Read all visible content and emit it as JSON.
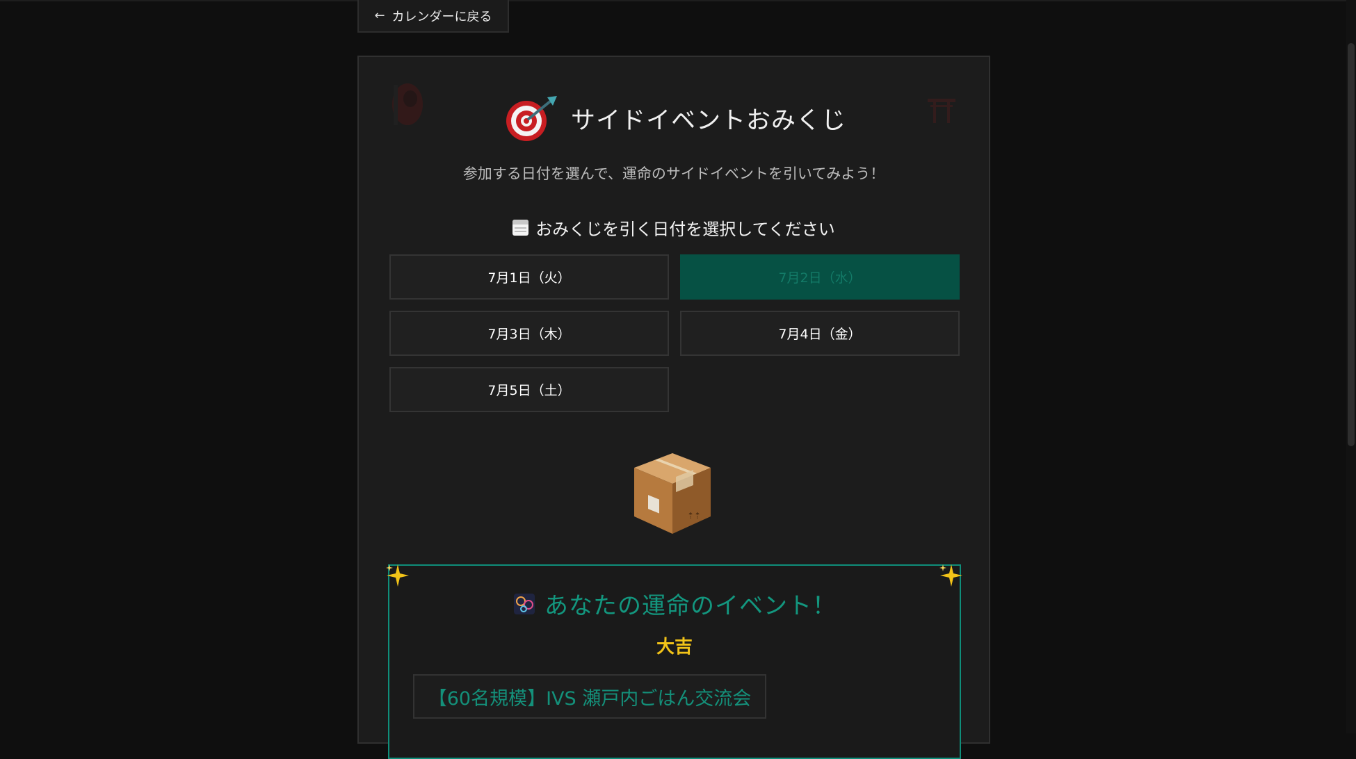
{
  "nav": {
    "back_label": "カレンダーに戻る",
    "back_icon": "arrow-left-icon"
  },
  "header": {
    "title": "サイドイベントおみくじ",
    "title_icon": "dart-target-icon",
    "subtitle": "参加する日付を選んで、運命のサイドイベントを引いてみよう！"
  },
  "date_select": {
    "heading": "おみくじを引く日付を選択してください",
    "heading_icon": "calendar-icon",
    "dates": [
      {
        "label": "7月1日（火）",
        "selected": false
      },
      {
        "label": "7月2日（水）",
        "selected": true
      },
      {
        "label": "7月3日（木）",
        "selected": false
      },
      {
        "label": "7月4日（金）",
        "selected": false
      },
      {
        "label": "7月5日（土）",
        "selected": false
      }
    ]
  },
  "draw_icon": "package-box-icon",
  "result": {
    "title": "あなたの運命のイベント！",
    "title_icon": "fireworks-icon",
    "fortune": "大吉",
    "event_name": "【60名規模】IVS 瀬戸内ごはん交流会"
  },
  "colors": {
    "background": "#0f0f0f",
    "panel": "#1c1c1c",
    "accent_teal": "#13977f",
    "selected_date": "#065144",
    "fortune_gold": "#f2c318"
  }
}
